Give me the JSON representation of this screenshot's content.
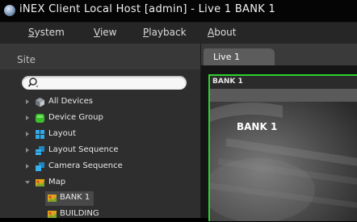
{
  "window": {
    "title": "iNEX Client Local Host [admin] - Live  1  BANK 1"
  },
  "menu": {
    "items": [
      {
        "u": "S",
        "rest": "ystem"
      },
      {
        "u": "V",
        "rest": "iew"
      },
      {
        "u": "P",
        "rest": "layback"
      },
      {
        "u": "A",
        "rest": "bout"
      }
    ]
  },
  "sidebar": {
    "title": "Site",
    "search": {
      "value": "",
      "placeholder": ""
    },
    "tree": [
      {
        "label": "All Devices",
        "icon": "devices-icon",
        "expanded": false
      },
      {
        "label": "Device Group",
        "icon": "device-group-icon",
        "expanded": false
      },
      {
        "label": "Layout",
        "icon": "layout-icon",
        "expanded": false
      },
      {
        "label": "Layout Sequence",
        "icon": "layout-sequence-icon",
        "expanded": false
      },
      {
        "label": "Camera Sequence",
        "icon": "camera-sequence-icon",
        "expanded": false
      },
      {
        "label": "Map",
        "icon": "map-icon",
        "expanded": true
      },
      {
        "label": "BANK 1",
        "icon": "map-item-icon",
        "selected": true
      },
      {
        "label": "BUILDING",
        "icon": "map-item-icon"
      }
    ]
  },
  "content": {
    "tab": {
      "label": "Live  1"
    },
    "camera": {
      "header": "BANK 1",
      "overlay_label": "BANK 1"
    }
  },
  "colors": {
    "active_border": "#2fd12f"
  }
}
